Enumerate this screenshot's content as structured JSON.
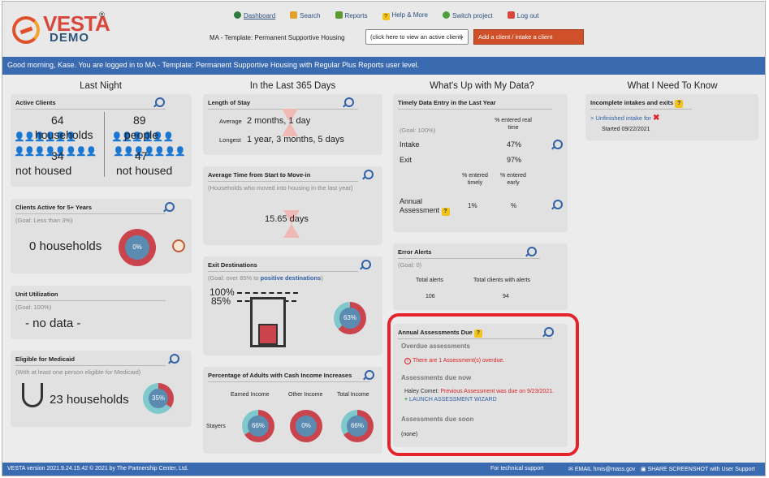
{
  "app": {
    "logo_text": "VESTA",
    "logo_reg": "®",
    "logo_sub": "DEMO"
  },
  "nav": [
    {
      "label": "Dashboard",
      "icon": "dashboard-icon",
      "color": "#2e7a3c"
    },
    {
      "label": "Search",
      "icon": "search-people-icon",
      "color": "#e3a32a"
    },
    {
      "label": "Reports",
      "icon": "reports-icon",
      "color": "#5b9a2f"
    },
    {
      "label": "Help & More",
      "icon": "help-icon",
      "color": "#f3c417"
    },
    {
      "label": "Switch project",
      "icon": "switch-icon",
      "color": "#4aa03a"
    },
    {
      "label": "Log out",
      "icon": "logout-icon",
      "color": "#d9463c"
    }
  ],
  "header": {
    "project_label": "MA - Template: Permanent Supportive Housing",
    "client_select": "(click here to view an active client)",
    "add_button": "Add a client / intake a client"
  },
  "greeting": "Good morning, Kase. You are logged in to MA - Template: Permanent Supportive Housing with Regular Plus Reports user level.",
  "columns": {
    "c1": "Last Night",
    "c2": "In the Last 365 Days",
    "c3": "What's Up with My Data?",
    "c4": "What I Need To Know"
  },
  "active": {
    "title": "Active Clients",
    "households": "64",
    "households_label": "households",
    "people": "89",
    "people_label": "people",
    "nh_households": "34",
    "nh_label": "not housed",
    "nh_people": "47",
    "nh_people_label": "not housed"
  },
  "five": {
    "title": "Clients Active for 5+ Years",
    "goal": "(Goal: Less than 3%)",
    "value": "0 households",
    "pct": "0%",
    "pct_num": 0
  },
  "unit": {
    "title": "Unit Utilization",
    "goal": "(Goal: 100%)",
    "value": "- no data -"
  },
  "medicaid": {
    "title": "Eligible for Medicaid",
    "goal": "(With at least one person eligible for Medicaid)",
    "value": "23 households",
    "pct": "35%",
    "pct_num": 35
  },
  "los": {
    "title": "Length of Stay",
    "avg_label": "Average",
    "avg": "2 months, 1 day",
    "long_label": "Longest",
    "long": "1 year, 3 months, 5 days"
  },
  "movein": {
    "title": "Average Time from Start to Move-in",
    "goal": "(Households who moved into housing in the last year)",
    "value": "15.65 days"
  },
  "exit": {
    "title": "Exit Destinations",
    "goal_pre": "(Goal: over 85% to ",
    "goal_link": "positive destinations",
    "goal_post": ")",
    "l100": "100%",
    "l85": "85%",
    "pct": "63%",
    "pct_num": 63
  },
  "cash": {
    "title": "Percentage of Adults with Cash Income Increases",
    "h1": "Earned Income",
    "h2": "Other Income",
    "h3": "Total Income",
    "row": "Stayers",
    "v1": "66%",
    "v2": "0%",
    "v3": "66%",
    "n1": 66,
    "n2": 0,
    "n3": 66
  },
  "timely": {
    "title": "Timely Data Entry in the Last Year",
    "goal": "(Goal: 100%)",
    "h_real": "% entered real time",
    "intake": "Intake",
    "intake_v": "47%",
    "exit": "Exit",
    "exit_v": "97%",
    "h_timely": "% entered timely",
    "h_early": "% entered early",
    "annual": "Annual Assessment",
    "annual_t": "1%",
    "annual_e": "%"
  },
  "errors": {
    "title": "Error Alerts",
    "goal": "(Goal: 0)",
    "h1": "Total alerts",
    "h2": "Total clients with alerts",
    "v1": "106",
    "v2": "94"
  },
  "annual": {
    "title": "Annual Assessments Due",
    "overdue_h": "Overdue assessments",
    "overdue_msg": "There are 1 Assessment(s) overdue.",
    "now_h": "Assessments due now",
    "name": "Haley Comet:",
    "prev": "Previous Assessment was due on 9/23/2021.",
    "wizard": "LAUNCH ASSESSMENT WIZARD",
    "soon_h": "Assessments due soon",
    "none": "(none)"
  },
  "incomplete": {
    "title": "Incomplete intakes and exits",
    "link": "> Unfinished intake for",
    "started": "Started 09/22/2021"
  },
  "footer": {
    "left_pre": "VESTA version 2021.9.24.15.42 © 2021 by ",
    "left_link": "The Partnership Center, Ltd.",
    "support": "For technical support",
    "email": "EMAIL hmis@mass.gov",
    "screenshot": "SHARE SCREENSHOT with User Support"
  },
  "colors": {
    "blue_bar": "#3a6ab0",
    "donut_red": "#c9444c",
    "donut_teal": "#7fc9cc",
    "highlight": "#e4232a"
  }
}
